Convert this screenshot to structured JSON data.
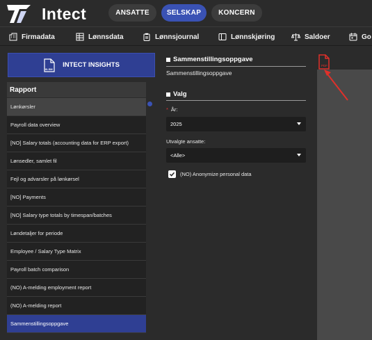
{
  "app": {
    "name": "Intect"
  },
  "tabs": [
    {
      "label": "ANSATTE",
      "active": false
    },
    {
      "label": "SELSKAP",
      "active": true
    },
    {
      "label": "KONCERN",
      "active": false
    }
  ],
  "nav": [
    {
      "label": "Firmadata",
      "icon": "building-icon"
    },
    {
      "label": "Lønnsdata",
      "icon": "grid-icon"
    },
    {
      "label": "Lønnsjournal",
      "icon": "clipboard-icon"
    },
    {
      "label": "Lønnskjøring",
      "icon": "book-icon"
    },
    {
      "label": "Saldoer",
      "icon": "scale-icon"
    },
    {
      "label": "Go",
      "icon": "calendar-icon"
    }
  ],
  "insights": {
    "label": "INTECT INSIGHTS",
    "icon_label": "XLSM"
  },
  "rapport": {
    "header": "Rapport",
    "items": [
      {
        "label": "Lønkørsler",
        "type": "group"
      },
      {
        "label": "Payroll data overview"
      },
      {
        "label": "[NO] Salary totals (accounting data for ERP export)"
      },
      {
        "label": "Lønsedler, samlet fil"
      },
      {
        "label": "Fejl og advarsler på lønkørsel"
      },
      {
        "label": "[NO] Payments"
      },
      {
        "label": "[NO] Salary type totals by timespan/batches"
      },
      {
        "label": "Løndetaljer for periode"
      },
      {
        "label": "Employee / Salary Type Matrix"
      },
      {
        "label": "Payroll batch comparison"
      },
      {
        "label": "(NO) A-melding employment report"
      },
      {
        "label": "(NO) A-melding report"
      },
      {
        "label": "Sammenstillingsoppgave",
        "selected": true
      }
    ]
  },
  "details": {
    "title": "Sammenstillingsoppgave",
    "description": "Sammenstillingsoppgave",
    "valg_title": "Valg",
    "year_label": "År:",
    "year_value": "2025",
    "employees_label": "Utvalgte ansatte:",
    "employees_value": "<Alle>",
    "anonymize_label": "(NO) Anonymize personal data",
    "anonymize_checked": true
  },
  "pdf": {
    "icon_label": "PDF",
    "icon": "pdf-file-icon"
  },
  "colors": {
    "accent": "#3a52b4",
    "selected_row": "#2f3f93",
    "pdf_red": "#e0302a",
    "background": "#2b2b2b"
  }
}
